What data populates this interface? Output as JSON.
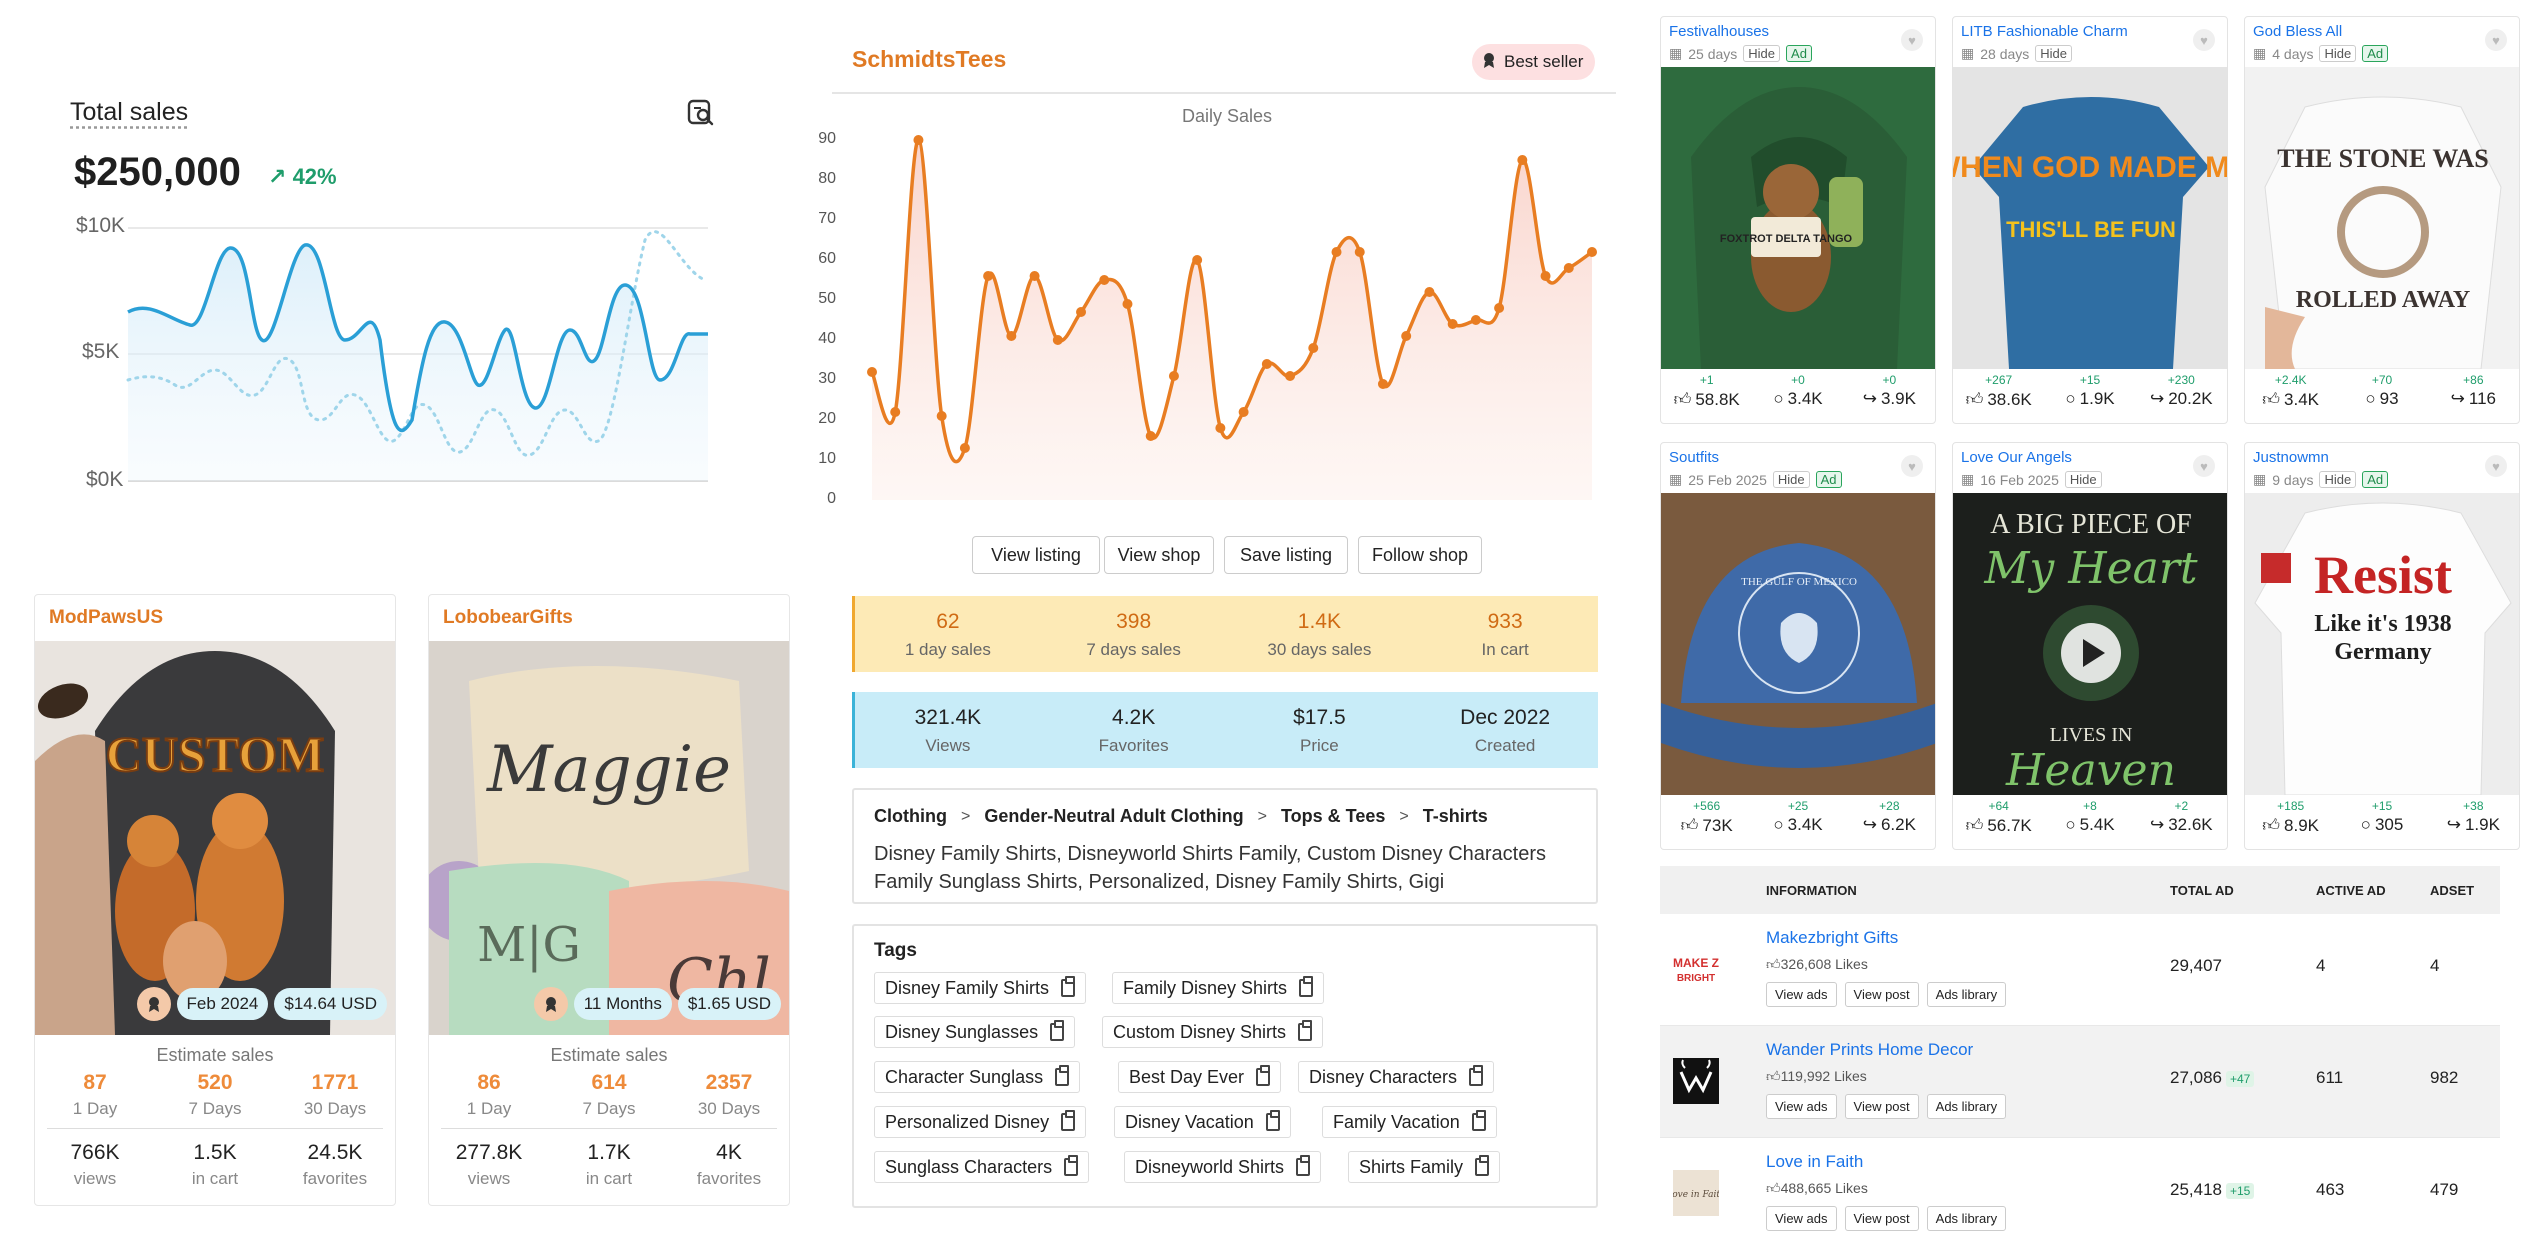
{
  "total_sales": {
    "title": "Total sales",
    "value": "$250,000",
    "change": "42%",
    "y_labels": [
      "$10K",
      "$5K",
      "$0K"
    ]
  },
  "shop_cards": [
    {
      "name": "ModPawsUS",
      "image_text": "CUSTOM",
      "date_badge": "Feb 2024",
      "price_badge": "$14.64 USD",
      "estimate_label": "Estimate sales",
      "sales": [
        {
          "value": "87",
          "label": "1 Day"
        },
        {
          "value": "520",
          "label": "7 Days"
        },
        {
          "value": "1771",
          "label": "30 Days"
        }
      ],
      "stats": [
        {
          "value": "766K",
          "label": "views"
        },
        {
          "value": "1.5K",
          "label": "in cart"
        },
        {
          "value": "24.5K",
          "label": "favorites"
        }
      ]
    },
    {
      "name": "LobobearGifts",
      "image_text": "Maggie",
      "image_text2": "M|G",
      "image_text3": "Chl",
      "date_badge": "11 Months",
      "price_badge": "$1.65 USD",
      "estimate_label": "Estimate sales",
      "sales": [
        {
          "value": "86",
          "label": "1 Day"
        },
        {
          "value": "614",
          "label": "7 Days"
        },
        {
          "value": "2357",
          "label": "30 Days"
        }
      ],
      "stats": [
        {
          "value": "277.8K",
          "label": "views"
        },
        {
          "value": "1.7K",
          "label": "in cart"
        },
        {
          "value": "4K",
          "label": "favorites"
        }
      ]
    }
  ],
  "center": {
    "shop_name": "SchmidtsTees",
    "best_seller": "Best seller",
    "buttons": [
      "View listing",
      "View shop",
      "Save listing",
      "Follow shop"
    ],
    "sales_band": [
      {
        "value": "62",
        "label": "1 day sales"
      },
      {
        "value": "398",
        "label": "7 days sales"
      },
      {
        "value": "1.4K",
        "label": "30 days sales"
      },
      {
        "value": "933",
        "label": "In cart"
      }
    ],
    "info_band": [
      {
        "value": "321.4K",
        "label": "Views"
      },
      {
        "value": "4.2K",
        "label": "Favorites"
      },
      {
        "value": "$17.5",
        "label": "Price"
      },
      {
        "value": "Dec 2022",
        "label": "Created"
      }
    ],
    "breadcrumbs": [
      "Clothing",
      "Gender-Neutral Adult Clothing",
      "Tops & Tees",
      "T-shirts"
    ],
    "description": "Disney Family Shirts, Disneyworld Shirts Family, Custom Disney Characters Family Sunglass Shirts, Personalized, Disney Family Shirts, Gigi",
    "tags_title": "Tags",
    "tags": [
      "Disney Family Shirts",
      "Family Disney Shirts",
      "Disney Sunglasses",
      "Custom Disney Shirts",
      "Character Sunglass",
      "Best Day Ever",
      "Disney Characters",
      "Personalized Disney",
      "Disney Vacation",
      "Family Vacation",
      "Sunglass Characters",
      "Disneyworld Shirts",
      "Shirts Family"
    ]
  },
  "chart_data": {
    "type": "line",
    "title": "Daily Sales",
    "ylim": [
      0,
      90
    ],
    "yticks": [
      0,
      10,
      20,
      30,
      40,
      50,
      60,
      70,
      80,
      90
    ],
    "values": [
      32,
      22,
      90,
      21,
      13,
      56,
      41,
      56,
      40,
      47,
      55,
      49,
      16,
      31,
      60,
      18,
      22,
      34,
      31,
      38,
      62,
      62,
      29,
      41,
      52,
      44,
      45,
      48,
      85,
      56,
      58,
      62
    ],
    "color": "#e87d22"
  },
  "ads": [
    {
      "name": "Festivalhouses",
      "age": "25 days",
      "hide": "Hide",
      "ad": "Ad",
      "image_text": "FOXTROT DELTA TANGO",
      "deltas": [
        "+1",
        "+0",
        "+0"
      ],
      "stats": [
        "58.8K",
        "3.4K",
        "3.9K"
      ]
    },
    {
      "name": "LITB Fashionable Charm",
      "age": "28 days",
      "hide": "Hide",
      "ad": "",
      "image_text": "WHEN GOD MADE ME",
      "image_sub": "THIS'LL BE FUN",
      "deltas": [
        "+267",
        "+15",
        "+230"
      ],
      "stats": [
        "38.6K",
        "1.9K",
        "20.2K"
      ]
    },
    {
      "name": "God Bless All",
      "age": "4 days",
      "hide": "Hide",
      "ad": "Ad",
      "image_text": "THE STONE WAS",
      "image_sub": "ROLLED AWAY",
      "deltas": [
        "+2.4K",
        "+70",
        "+86"
      ],
      "stats": [
        "3.4K",
        "93",
        "116"
      ]
    },
    {
      "name": "Soutfits",
      "age": "25 Feb 2025",
      "hide": "Hide",
      "ad": "Ad",
      "image_text": "THE GULF OF MEXICO",
      "deltas": [
        "+566",
        "+25",
        "+28"
      ],
      "stats": [
        "73K",
        "3.4K",
        "6.2K"
      ]
    },
    {
      "name": "Love Our Angels",
      "age": "16 Feb 2025",
      "hide": "Hide",
      "ad": "",
      "image_text": "A BIG PIECE OF",
      "image_sub": "My Heart",
      "image_sub2": "LIVES IN",
      "image_sub3": "Heaven",
      "deltas": [
        "+64",
        "+8",
        "+2"
      ],
      "stats": [
        "56.7K",
        "5.4K",
        "32.6K"
      ]
    },
    {
      "name": "Justnowmn",
      "age": "9 days",
      "hide": "Hide",
      "ad": "Ad",
      "image_text": "Resist",
      "image_sub": "Like it's 1938",
      "image_sub2": "Germany",
      "deltas": [
        "+185",
        "+15",
        "+38"
      ],
      "stats": [
        "8.9K",
        "305",
        "1.9K"
      ]
    }
  ],
  "table": {
    "headers": [
      "INFORMATION",
      "TOTAL AD",
      "ACTIVE AD",
      "ADSET"
    ],
    "buttons": [
      "View ads",
      "View post",
      "Ads library"
    ],
    "rows": [
      {
        "name": "Makezbright Gifts",
        "likes": "326,608 Likes",
        "logo": "MAKE Z BRIGHT",
        "total": "29,407",
        "gain": "",
        "active": "4",
        "adset": "4"
      },
      {
        "name": "Wander Prints Home Decor",
        "likes": "119,992 Likes",
        "logo": "",
        "total": "27,086",
        "gain": "+47",
        "active": "611",
        "adset": "982"
      },
      {
        "name": "Love in Faith",
        "likes": "488,665 Likes",
        "logo": "Love in Faith",
        "total": "25,418",
        "gain": "+15",
        "active": "463",
        "adset": "479"
      }
    ]
  },
  "colors": {
    "orange": "#e07a24",
    "blue": "#1a73e8",
    "green": "#1f9d6b",
    "line_blue": "#2a9fd6"
  }
}
